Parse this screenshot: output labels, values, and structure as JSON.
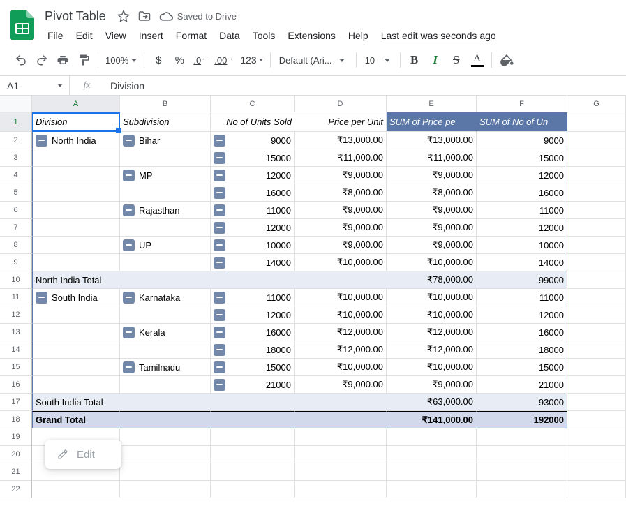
{
  "doc": {
    "title": "Pivot Table",
    "saved": "Saved to Drive",
    "last_edit": "Last edit was seconds ago"
  },
  "menus": [
    "File",
    "Edit",
    "View",
    "Insert",
    "Format",
    "Data",
    "Tools",
    "Extensions",
    "Help"
  ],
  "toolbar": {
    "zoom": "100%",
    "dollar": "$",
    "percent": "%",
    "dec_dec": ".0",
    "dec_inc": ".00",
    "num_fmt": "123",
    "font": "Default (Ari...",
    "font_size": "10",
    "bold": "B",
    "italic": "I",
    "strike": "S",
    "textcolor": "A"
  },
  "namebox": "A1",
  "formula": "Division",
  "columns": [
    "",
    "A",
    "B",
    "C",
    "D",
    "E",
    "F",
    "G"
  ],
  "headers": {
    "A": "Division",
    "B": "Subdivision",
    "C": "No of Units Sold",
    "D": "Price per Unit",
    "E": "SUM of Price pe",
    "F": "SUM of No of Un"
  },
  "rows": [
    {
      "n": 2,
      "div": "North India",
      "sub": "Bihar",
      "u": "9000",
      "p": "₹13,000.00",
      "sp": "₹13,000.00",
      "su": "9000"
    },
    {
      "n": 3,
      "div": "",
      "sub": "",
      "u": "15000",
      "p": "₹11,000.00",
      "sp": "₹11,000.00",
      "su": "15000"
    },
    {
      "n": 4,
      "div": "",
      "sub": "MP",
      "u": "12000",
      "p": "₹9,000.00",
      "sp": "₹9,000.00",
      "su": "12000"
    },
    {
      "n": 5,
      "div": "",
      "sub": "",
      "u": "16000",
      "p": "₹8,000.00",
      "sp": "₹8,000.00",
      "su": "16000"
    },
    {
      "n": 6,
      "div": "",
      "sub": "Rajasthan",
      "u": "11000",
      "p": "₹9,000.00",
      "sp": "₹9,000.00",
      "su": "11000"
    },
    {
      "n": 7,
      "div": "",
      "sub": "",
      "u": "12000",
      "p": "₹9,000.00",
      "sp": "₹9,000.00",
      "su": "12000"
    },
    {
      "n": 8,
      "div": "",
      "sub": "UP",
      "u": "10000",
      "p": "₹9,000.00",
      "sp": "₹9,000.00",
      "su": "10000"
    },
    {
      "n": 9,
      "div": "",
      "sub": "",
      "u": "14000",
      "p": "₹10,000.00",
      "sp": "₹10,000.00",
      "su": "14000"
    }
  ],
  "subtotal1": {
    "n": 10,
    "label": "North India Total",
    "sp": "₹78,000.00",
    "su": "99000"
  },
  "rows2": [
    {
      "n": 11,
      "div": "South India",
      "sub": "Karnataka",
      "u": "11000",
      "p": "₹10,000.00",
      "sp": "₹10,000.00",
      "su": "11000"
    },
    {
      "n": 12,
      "div": "",
      "sub": "",
      "u": "12000",
      "p": "₹10,000.00",
      "sp": "₹10,000.00",
      "su": "12000"
    },
    {
      "n": 13,
      "div": "",
      "sub": "Kerala",
      "u": "16000",
      "p": "₹12,000.00",
      "sp": "₹12,000.00",
      "su": "16000"
    },
    {
      "n": 14,
      "div": "",
      "sub": "",
      "u": "18000",
      "p": "₹12,000.00",
      "sp": "₹12,000.00",
      "su": "18000"
    },
    {
      "n": 15,
      "div": "",
      "sub": "Tamilnadu",
      "u": "15000",
      "p": "₹10,000.00",
      "sp": "₹10,000.00",
      "su": "15000"
    },
    {
      "n": 16,
      "div": "",
      "sub": "",
      "u": "21000",
      "p": "₹9,000.00",
      "sp": "₹9,000.00",
      "su": "21000"
    }
  ],
  "subtotal2": {
    "n": 17,
    "label": "South India Total",
    "sp": "₹63,000.00",
    "su": "93000"
  },
  "grand": {
    "n": 18,
    "label": "Grand Total",
    "sp": "₹141,000.00",
    "su": "192000"
  },
  "blank_rows": [
    19,
    20,
    21,
    22
  ],
  "edit_btn": "Edit"
}
